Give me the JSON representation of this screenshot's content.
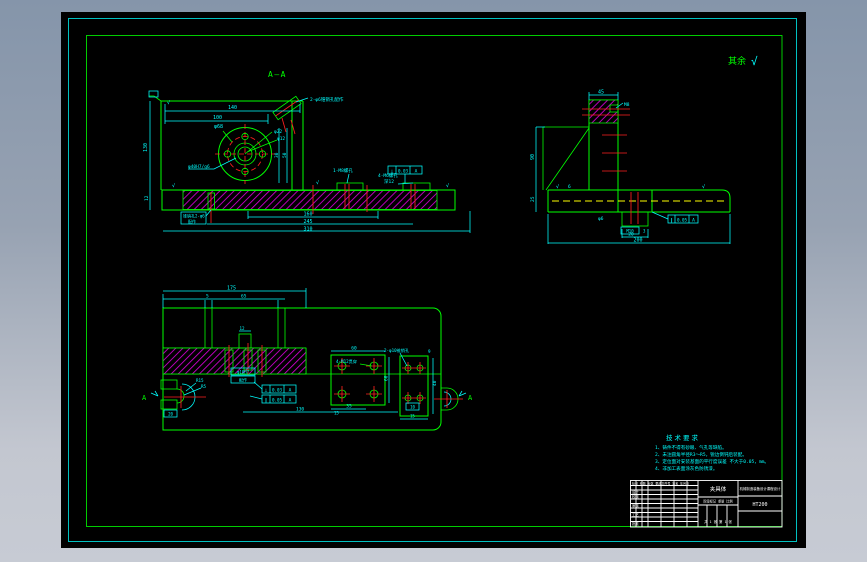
{
  "corner": {
    "rest": "其余",
    "check": "√"
  },
  "marks": {
    "check": "√"
  },
  "front": {
    "section_label": "A—A",
    "dims": {
      "w140": "140",
      "w100": "100",
      "h130": "130",
      "h12": "12",
      "v30": "30",
      "v50": "50",
      "b160": "160",
      "b245": "245",
      "b310": "310"
    },
    "labels": {
      "pin_top": "2-φ6锥销孔配作",
      "dia68": "φ68",
      "dia22": "φ22",
      "dia12": "φ12",
      "hub": "φ40H7/g6",
      "m8": "1-M8螺孔",
      "m6a": "4-M6螺孔",
      "m6b": "深12",
      "pin2a": "锥销孔2-φ6",
      "pin2b": "配作"
    },
    "tol": {
      "sym": "⊥",
      "val": "0.03",
      "ref": "A"
    }
  },
  "side": {
    "dims": {
      "t45": "45",
      "h90": "90",
      "h25": "25",
      "r6": "6",
      "b20": "20",
      "b200": "200",
      "d3": "3"
    },
    "labels": {
      "m8": "M8",
      "phi6": "φ6",
      "m10": "M10"
    },
    "tol": {
      "sym": "∥",
      "val": "0.05",
      "ref": "A"
    }
  },
  "plan": {
    "dims": {
      "t175": "175",
      "t5": "5",
      "t65": "65",
      "d9": "9",
      "d12": "12",
      "p60t": "60",
      "p60r": "60",
      "p35": "35",
      "p15": "15",
      "p130": "130",
      "q40": "40",
      "q15": "15",
      "q10": "10",
      "s20": "20"
    },
    "labels": {
      "r15": "R15",
      "r5": "R5",
      "m12": "4-M12贯穿",
      "pins": "2-φ10锥销孔",
      "slot1": "φ10H7",
      "slot2": "配作",
      "section": "A"
    },
    "tol1": {
      "sym": "⊥",
      "val": "0.03",
      "ref": "A"
    },
    "tol2": {
      "sym": "∥",
      "val": "0.05",
      "ref": "A"
    }
  },
  "notes": {
    "title": "技术要求",
    "items": [
      "1、铸件不得有砂眼、气孔等缺陷。",
      "2、未注圆角半径R3～R5，锐边倒钝后装配。",
      "3、定位面对安装基面的平行度误差 不大于0.05，mm。",
      "4、非加工表面涂灰色防锈漆。"
    ]
  },
  "title_block": {
    "part_name": "夹具体",
    "org": "机械制造装备设计课程设计",
    "material": "HT200",
    "header": "标记 处数 分区 更改文件号 签名 年月日",
    "rows": [
      "设计",
      "校核",
      "审核",
      "工艺",
      "批准"
    ],
    "scale_row": "阶段标记 重量 比例",
    "sheet_row": "共 1 张 第 1 张"
  }
}
